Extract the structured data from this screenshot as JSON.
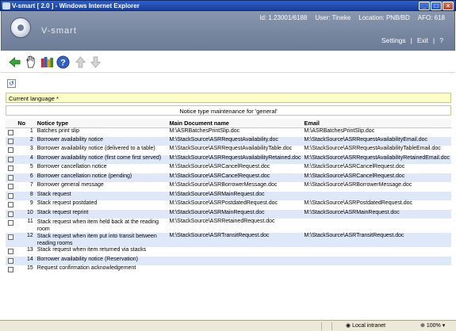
{
  "window": {
    "title": "V-smart [ 2.0 ] - Windows Internet Explorer"
  },
  "header": {
    "brand": "V-smart",
    "id_text": "Id: 1.23001/6188",
    "user_text": "User: Tineke",
    "location_text": "Location: PNB/BD",
    "afo_text": "AFO: 618",
    "settings_label": "Settings",
    "exit_label": "Exit",
    "link_sep": "|",
    "help_label": "?"
  },
  "toolbar": {
    "icons": [
      "back-arrow-icon",
      "hand-select-icon",
      "books-icon",
      "help-icon",
      "arrow-up-icon",
      "arrow-down-icon"
    ]
  },
  "language_bar": {
    "label": "Current language *"
  },
  "caption": {
    "label": "Notice type maintenance for 'general'"
  },
  "table": {
    "headers": {
      "no": "No",
      "notice_type": "Notice type",
      "main_doc": "Main Document name",
      "email": "Email"
    },
    "rows": [
      {
        "no": "1",
        "type": "Batches print slip",
        "doc": "M:\\ASRBatchesPrintSlip.doc",
        "email": "M:\\ASRBatchesPrintSlip.doc"
      },
      {
        "no": "2",
        "type": "Borrower availability notice",
        "doc": "M:\\StackSource\\ASRRequestAvailability.doc",
        "email": "M:\\StackSource\\ASRRequestAvailabilityEmail.doc"
      },
      {
        "no": "3",
        "type": "Borrower availability notice (delivered to a table)",
        "doc": "M:\\StackSource\\ASRRequestAvailabilityTable.doc",
        "email": "M:\\StackSource\\ASRRequestAvailabilityTableEmail.doc"
      },
      {
        "no": "4",
        "type": "Borrower availability notice (first come first served)",
        "doc": "M:\\StackSource\\ASRRequestAvailabilityRetained.doc",
        "email": "M:\\StackSource\\ASRRequestAvailabilityRetainedEmail.doc"
      },
      {
        "no": "5",
        "type": "Borrower cancellation notice",
        "doc": "M:\\StackSource\\ASRCancelRequest.doc",
        "email": "M:\\StackSource\\ASRCancelRequest.doc"
      },
      {
        "no": "6",
        "type": "Borrower cancellation notice (pending)",
        "doc": "M:\\StackSource\\ASRCancelRequest.doc",
        "email": "M:\\StackSource\\ASRCancelRequest.doc"
      },
      {
        "no": "7",
        "type": "Borrower general message",
        "doc": "M:\\StackSource\\ASRBorrowerMessage.doc",
        "email": "M:\\StackSource\\ASRBorrowerMessage.doc"
      },
      {
        "no": "8",
        "type": "Stack request",
        "doc": "M:\\StackSource\\ASRMainRequest.doc",
        "email": ""
      },
      {
        "no": "9",
        "type": "Stack request postdated",
        "doc": "M:\\StackSource\\ASRPostdatedRequest.doc",
        "email": "M:\\StackSource\\ASRPostdatedRequest.doc"
      },
      {
        "no": "10",
        "type": "Stack request reprint",
        "doc": "M:\\StackSource\\ASRMainRequest.doc",
        "email": "M:\\StackSource\\ASRMainRequest.doc"
      },
      {
        "no": "11",
        "type": "Stack request when item held back at the reading room",
        "doc": "M:\\StackSource\\ASRRetainedRequest.doc",
        "email": ""
      },
      {
        "no": "12",
        "type": "Stack request when item put into transit between reading rooms",
        "doc": "M:\\StackSource\\ASRTransitRequest.doc",
        "email": "M:\\StackSource\\ASRTransitRequest.doc"
      },
      {
        "no": "13",
        "type": "Stack request when item returned via stacks",
        "doc": "",
        "email": ""
      },
      {
        "no": "14",
        "type": "Borrower availability notice (Reservation)",
        "doc": "",
        "email": ""
      },
      {
        "no": "15",
        "type": "Request confirmation acknowledgement",
        "doc": "",
        "email": ""
      }
    ]
  },
  "statusbar": {
    "zone": "Local intranet",
    "zoom": "100%"
  },
  "colors": {
    "header_bg": "#7a88a2",
    "row_alt": "#dfe8f8",
    "lang_bar": "#fdfdc8"
  }
}
